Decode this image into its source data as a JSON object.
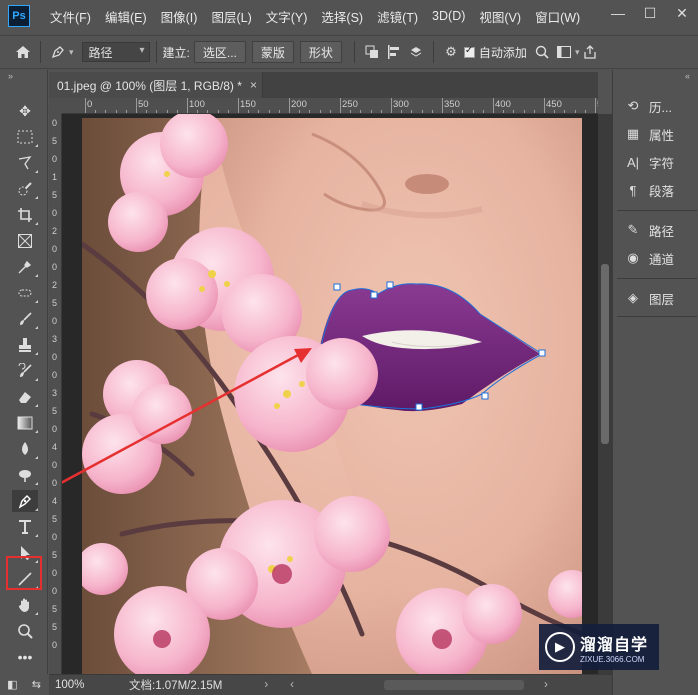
{
  "app": {
    "logo": "Ps"
  },
  "menu": [
    "文件(F)",
    "编辑(E)",
    "图像(I)",
    "图层(L)",
    "文字(Y)",
    "选择(S)",
    "滤镜(T)",
    "3D(D)",
    "视图(V)",
    "窗口(W)"
  ],
  "window_controls": {
    "minimize": "—",
    "maximize": "☐",
    "close": "✕"
  },
  "options_bar": {
    "mode_value": "路径",
    "build_label": "建立:",
    "selection_button": "选区...",
    "mask_button": "蒙版",
    "shape_button": "形状",
    "auto_add_label": "自动添加"
  },
  "document": {
    "tab_title": "01.jpeg @ 100% (图层 1, RGB/8) *",
    "close": "×"
  },
  "ruler": {
    "h_labels": [
      "0",
      "50",
      "100",
      "150",
      "200",
      "250",
      "300",
      "350",
      "400",
      "450",
      "500"
    ],
    "v_labels": [
      "0",
      "5",
      "0",
      "1",
      "5",
      "0",
      "2",
      "0",
      "0",
      "2",
      "5",
      "0",
      "3",
      "0",
      "0",
      "3",
      "5",
      "0",
      "4",
      "0",
      "0",
      "4",
      "5",
      "0",
      "5",
      "0",
      "0",
      "5",
      "5",
      "0"
    ]
  },
  "status": {
    "zoom": "100%",
    "doc_info": "文档:1.07M/2.15M",
    "prev": "‹",
    "next": "›"
  },
  "panels": [
    {
      "icon": "history-icon",
      "label": "历..."
    },
    {
      "icon": "properties-icon",
      "label": "属性"
    },
    {
      "icon": "character-icon",
      "label": "字符"
    },
    {
      "icon": "paragraph-icon",
      "label": "段落"
    },
    {
      "icon": "paths-icon",
      "label": "路径"
    },
    {
      "icon": "channels-icon",
      "label": "通道"
    },
    {
      "icon": "layers-icon",
      "label": "图层"
    }
  ],
  "panel_icons": {
    "history": "⟲",
    "properties": "▦",
    "character": "A|",
    "paragraph": "¶",
    "paths": "✎",
    "channels": "◉",
    "layers": "◈"
  },
  "watermark": {
    "main": "溜溜自学",
    "sub": "ZIXUE.3066.COM",
    "logo": "▶"
  },
  "colors": {
    "accent_red": "#e63030",
    "path_blue": "#1e6fd8",
    "lip_purple": "#7a2a80",
    "skin": "#e8b9a8"
  }
}
